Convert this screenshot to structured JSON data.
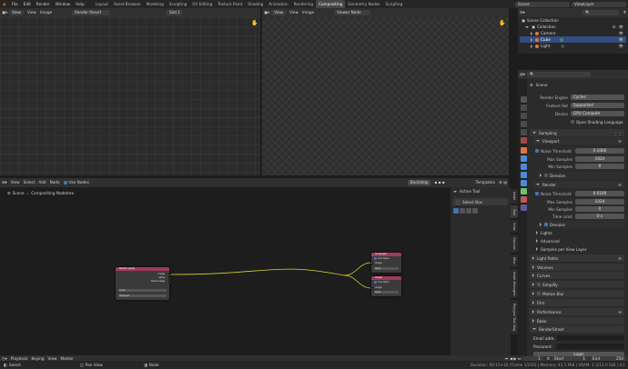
{
  "menu": [
    "File",
    "Edit",
    "Render",
    "Window",
    "Help"
  ],
  "workspaces": [
    "Layout",
    "Asset Browser",
    "Modeling",
    "Sculpting",
    "UV Editing",
    "Texture Paint",
    "Shading",
    "Animation",
    "Rendering",
    "Compositing",
    "Geometry Nodes",
    "Scripting"
  ],
  "active_workspace": "Compositing",
  "scene_field": "Scene",
  "viewlayer_field": "ViewLayer",
  "image_editor_left": {
    "view": "View",
    "view2": "View",
    "image": "Image",
    "image_name": "Render Result",
    "slot": "Slot 1"
  },
  "image_editor_right": {
    "view": "View",
    "view2": "View",
    "image": "Image",
    "image_name": "Viewer Node"
  },
  "node_editor": {
    "menu": [
      "View",
      "Select",
      "Add",
      "Node"
    ],
    "use_nodes": "Use Nodes",
    "backdrop": "Backdrop",
    "templates": "Templates",
    "breadcrumb_scene": "Scene",
    "breadcrumb_tree": "Compositing Nodetree",
    "render_layers_node": {
      "title": "Render Layers",
      "outputs": [
        "Image",
        "Alpha",
        "Noise Image"
      ],
      "scene": "Scene",
      "layer": "ViewLayer"
    },
    "composite_node": {
      "title": "Composite",
      "use_alpha": "Use Alpha",
      "inputs": [
        "Image",
        "Alpha"
      ]
    },
    "viewer_node": {
      "title": "Viewer",
      "use_alpha": "Use Alpha",
      "inputs": [
        "Image",
        "Alpha"
      ]
    }
  },
  "tool_panel": {
    "title": "Active Tool",
    "tool": "Select Box"
  },
  "node_side_tabs": [
    "Node",
    "Tool",
    "View",
    "Options",
    "Misc",
    "Node Wrangler",
    "Polygon Tool Bag"
  ],
  "outliner": {
    "rows": [
      {
        "label": "Scene Collection"
      },
      {
        "label": "Collection"
      },
      {
        "label": "Camera"
      },
      {
        "label": "Cube"
      },
      {
        "label": "Light"
      }
    ]
  },
  "properties": {
    "scene_title": "Scene",
    "render_engine_label": "Render Engine",
    "render_engine": "Cycles",
    "feature_set_label": "Feature Set",
    "feature_set": "Supported",
    "device_label": "Device",
    "device": "GPU Compute",
    "osl": "Open Shading Language",
    "sampling": "Sampling",
    "viewport": "Viewport",
    "noise_threshold_label": "Noise Threshold",
    "viewport_noise_threshold": "0.1000",
    "max_samples_label": "Max Samples",
    "viewport_max_samples": "1024",
    "min_samples_label": "Min Samples",
    "viewport_min_samples": "0",
    "denoise": "Denoise",
    "render": "Render",
    "render_noise_threshold": "0.0100",
    "render_max_samples": "1024",
    "render_min_samples": "0",
    "time_limit_label": "Time Limit",
    "time_limit": "0 s",
    "render_denoise": "Denoise",
    "lights": "Lights",
    "advanced": "Advanced",
    "samples_per_view_layer": "Samples per View Layer",
    "light_paths": "Light Paths",
    "volumes": "Volumes",
    "curves": "Curves",
    "simplify": "Simplify",
    "motion_blur": "Motion Blur",
    "film": "Film",
    "performance": "Performance",
    "bake": "Bake",
    "renderstreet": "RenderStreet",
    "email_label": "Email addr...",
    "password_label": "Password:",
    "login": "Login"
  },
  "timeline": {
    "playback": "Playback",
    "keying": "Keying",
    "view": "View",
    "marker": "Marker",
    "current_frame": "1",
    "start_label": "Start",
    "start": "1",
    "end_label": "End",
    "end": "250"
  },
  "status_bar": {
    "select": "Select",
    "pan_view": "Pan View",
    "node": "Node",
    "info": "Duration: 00:10+10 (Frame 1/250) | Memory: 41.1 MiB | VRAM: 1.5/12.0 GiB | 4.1"
  },
  "colors": {
    "render_layers_header": "#a23a5a",
    "composite_header": "#a23a5a",
    "link_color": "#d6d62c",
    "accent": "#4772b3"
  }
}
